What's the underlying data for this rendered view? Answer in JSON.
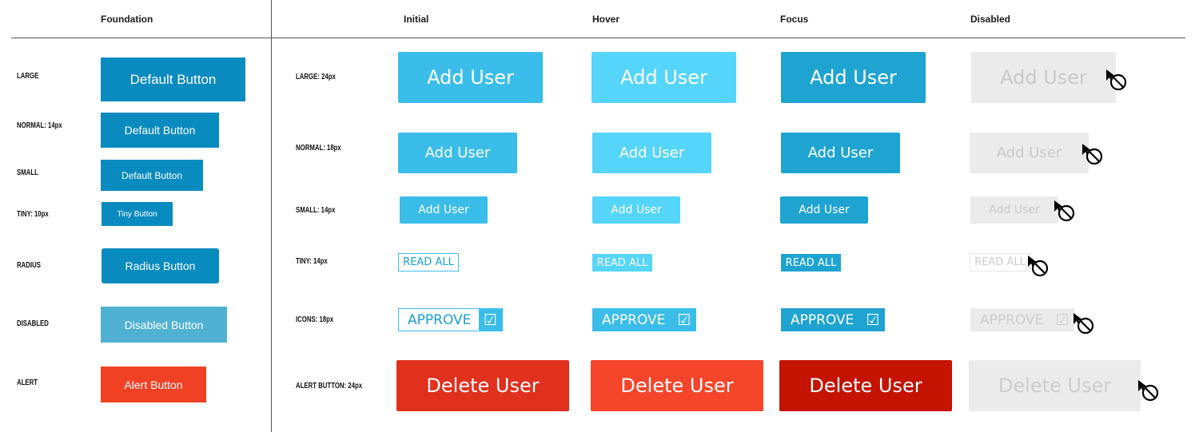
{
  "headers": {
    "foundation": "Foundation",
    "initial": "Initial",
    "hover": "Hover",
    "focus": "Focus",
    "disabled": "Disabled"
  },
  "foundation_rows": {
    "large": {
      "label": "LARGE",
      "button": "Default Button"
    },
    "normal": {
      "label": "NORMAL: 14px",
      "button": "Default Button"
    },
    "small": {
      "label": "SMALL",
      "button": "Default Button"
    },
    "tiny": {
      "label": "TINY: 10px",
      "button": "Tiny Button"
    },
    "radius": {
      "label": "RADIUS",
      "button": "Radius Button"
    },
    "disabled": {
      "label": "DISABLED",
      "button": "Disabled Button"
    },
    "alert": {
      "label": "ALERT",
      "button": "Alert Button"
    }
  },
  "state_rows": {
    "large": {
      "label": "LARGE: 24px",
      "button": "Add User"
    },
    "normal": {
      "label": "NORMAL: 18px",
      "button": "Add User"
    },
    "small": {
      "label": "SMALL: 14px",
      "button": "Add User"
    },
    "tiny": {
      "label": "TINY: 14px",
      "button": "READ ALL"
    },
    "icons": {
      "label": "ICONS: 18px",
      "button": "APPROVE",
      "icon": "checkbox-icon"
    },
    "alert": {
      "label": "ALERT BUTTON: 24px",
      "button": "Delete User"
    }
  },
  "colors": {
    "foundation_blue": "#0a8bbf",
    "foundation_disabled": "#4fb0d2",
    "foundation_alert": "#f04124",
    "initial_blue": "#3bbde9",
    "hover_blue": "#56d5fb",
    "focus_blue": "#1fa4d1",
    "disabled_gray": "#ebebeb",
    "disabled_text": "#c9c9c9",
    "alert_initial": "#e0301e",
    "alert_hover": "#f5452b",
    "alert_focus": "#c41300"
  },
  "icons": {
    "checkbox": "☑",
    "cursor": "not-allowed-cursor-icon"
  }
}
